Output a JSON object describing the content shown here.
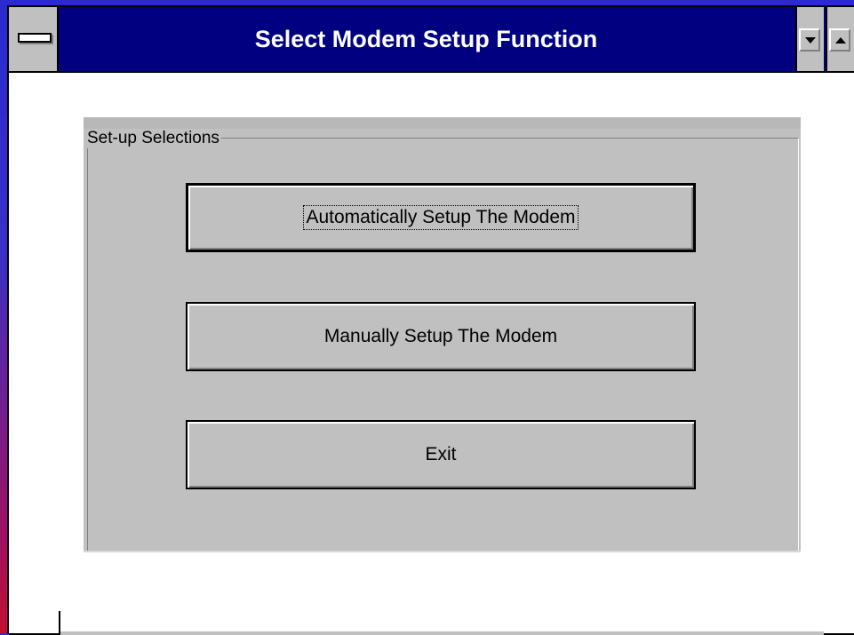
{
  "window": {
    "title": "Select Modem Setup Function"
  },
  "group": {
    "label": "Set-up Selections"
  },
  "buttons": {
    "auto": "Automatically Setup The Modem",
    "manual": "Manually Setup The Modem",
    "exit": "Exit"
  },
  "icons": {
    "system_menu": "system-menu-icon",
    "minimize": "minimize-arrow-icon",
    "maximize": "maximize-arrow-icon"
  },
  "colors": {
    "titlebar": "#000080",
    "button_face": "#c0c0c0",
    "desktop_top": "#2a2ad0",
    "desktop_bottom": "#c01030"
  }
}
